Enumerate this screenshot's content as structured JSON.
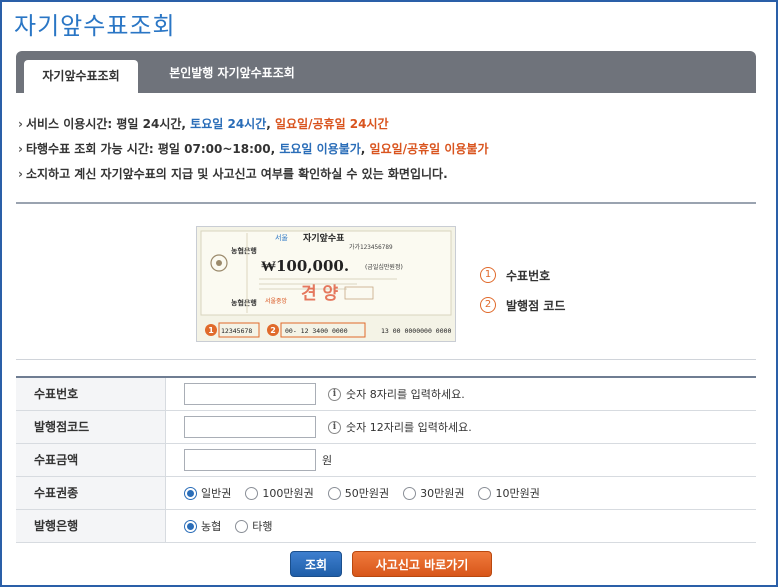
{
  "page_title": "자기앞수표조회",
  "tabs": [
    {
      "label": "자기앞수표조회",
      "active": true
    },
    {
      "label": "본인발행 자기앞수표조회",
      "active": false
    }
  ],
  "notes": {
    "line1": {
      "prefix": "서비스 이용시간: 평일 24시간, ",
      "blue": "토요일 24시간",
      "sep": ", ",
      "orange": "일요일/공휴일 24시간"
    },
    "line2": {
      "prefix": "타행수표 조회 가능 시간: 평일 07:00~18:00, ",
      "blue": "토요일 이용불가",
      "sep": ", ",
      "orange": "일요일/공휴일 이용불가"
    },
    "line3": "소지하고 계신 자기앞수표의 지급 및 사고신고 여부를 확인하실 수 있는 화면입니다."
  },
  "check_sample": {
    "bank": "농협은행",
    "title": "자기앞수표",
    "region": "서울",
    "serial_top": "가가123456789",
    "amount": "₩100,000.",
    "amount_words": "(금일십만원정)",
    "stamp": "견  양",
    "branch": "서울중앙",
    "marker1": "1",
    "marker2": "2",
    "check_number": "12345678",
    "branch_code": "00-  12  3400   0000",
    "extra_code": "13 00 0000000 0000"
  },
  "legend": [
    {
      "num": "1",
      "label": "수표번호"
    },
    {
      "num": "2",
      "label": "발행점 코드"
    }
  ],
  "form": {
    "check_number": {
      "label": "수표번호",
      "value": "",
      "hint": "숫자 8자리를 입력하세요."
    },
    "branch_code": {
      "label": "발행점코드",
      "value": "",
      "hint": "숫자 12자리를 입력하세요."
    },
    "amount": {
      "label": "수표금액",
      "value": "",
      "unit": "원"
    },
    "denomination": {
      "label": "수표권종",
      "options": [
        "일반권",
        "100만원권",
        "50만원권",
        "30만원권",
        "10만원권"
      ],
      "selected": "일반권"
    },
    "issuing_bank": {
      "label": "발행은행",
      "options": [
        "농협",
        "타행"
      ],
      "selected": "농협"
    }
  },
  "buttons": {
    "search": "조회",
    "report": "사고신고 바로가기"
  },
  "colors": {
    "accent_blue": "#2a76c5",
    "tab_bg": "#6f737b",
    "orange": "#d9541e"
  }
}
